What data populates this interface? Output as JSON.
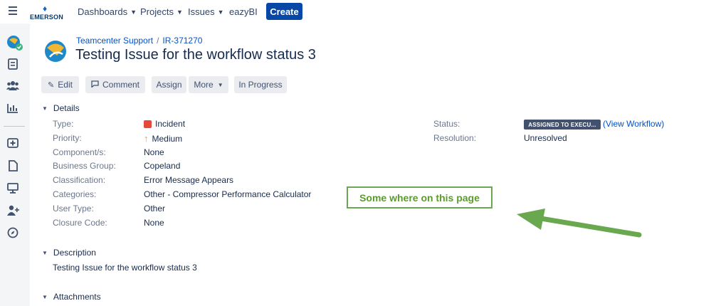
{
  "topnav": {
    "logo_text": "EMERSON",
    "items": [
      {
        "label": "Dashboards"
      },
      {
        "label": "Projects"
      },
      {
        "label": "Issues"
      },
      {
        "label": "eazyBI"
      }
    ],
    "create_label": "Create"
  },
  "sidebar": {
    "icons": [
      "project-avatar-icon",
      "backlog-icon",
      "people-icon",
      "reports-icon",
      "add-item-icon",
      "page-icon",
      "monitor-icon",
      "add-user-icon",
      "compass-icon"
    ]
  },
  "header": {
    "project": "Teamcenter Support",
    "separator": "/",
    "issue_key": "IR-371270",
    "title": "Testing Issue for the workflow status 3"
  },
  "toolbar": {
    "edit": "Edit",
    "comment": "Comment",
    "assign": "Assign",
    "more": "More",
    "in_progress": "In Progress"
  },
  "details": {
    "heading": "Details",
    "left": [
      {
        "label": "Type:",
        "value": "Incident"
      },
      {
        "label": "Priority:",
        "value": "Medium"
      },
      {
        "label": "Component/s:",
        "value": "None"
      },
      {
        "label": "Business Group:",
        "value": "Copeland"
      },
      {
        "label": "Classification:",
        "value": "Error Message Appears"
      },
      {
        "label": "Categories:",
        "value": "Other - Compressor Performance Calculator"
      },
      {
        "label": "User Type:",
        "value": "Other"
      },
      {
        "label": "Closure Code:",
        "value": "None"
      }
    ],
    "status_label": "Status:",
    "status_value": "ASSIGNED TO EXECU...",
    "view_workflow": "(View Workflow)",
    "resolution_label": "Resolution:",
    "resolution_value": "Unresolved"
  },
  "description": {
    "heading": "Description",
    "text": "Testing Issue for the workflow status 3"
  },
  "attachments": {
    "heading": "Attachments"
  },
  "annotation": {
    "callout_text": "Some where on this page",
    "arrow_color": "#6aa84f"
  },
  "colors": {
    "create_button": "#0747a6",
    "link": "#0052cc",
    "incident_icon": "#e5493a",
    "priority_medium": "#f79232"
  }
}
